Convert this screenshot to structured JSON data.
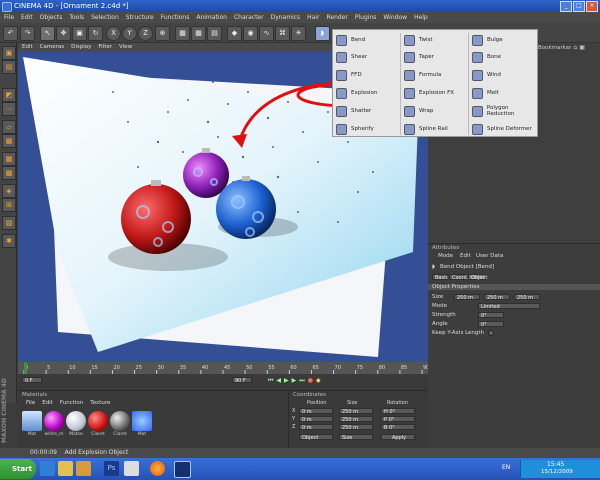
{
  "title": "CINEMA 4D - [Ornament 2.c4d *]",
  "menu": [
    "File",
    "Edit",
    "Objects",
    "Tools",
    "Selection",
    "Structure",
    "Functions",
    "Animation",
    "Character",
    "Dynamics",
    "Hair",
    "Render",
    "Plugins",
    "Window",
    "Help"
  ],
  "viewport_menu": [
    "Edit",
    "Cameras",
    "Display",
    "Filter",
    "View"
  ],
  "right_header": "Bookmarks",
  "deformers": [
    [
      "Bend",
      "Shear",
      "FFD",
      "Explosion",
      "Shatter",
      "Spherify"
    ],
    [
      "Twist",
      "Taper",
      "Formula",
      "Explosion FX",
      "Wrap",
      "Spline Rail"
    ],
    [
      "Bulge",
      "Bone",
      "Wind",
      "Melt",
      "Polygon Reduction",
      "Spline Deformer"
    ]
  ],
  "attributes": {
    "header": "Attributes",
    "tabs": [
      "Mode",
      "Edit",
      "User Data"
    ],
    "object_name": "Bend Object [Bend]",
    "subtabs": [
      "Basic",
      "Coord.",
      "Object"
    ],
    "section": "Object Properties",
    "size_label": "Size",
    "size_values": [
      "250 m",
      "250 m",
      "250 m"
    ],
    "mode_label": "Mode",
    "mode_value": "Limited",
    "strength_label": "Strength",
    "strength_value": "0°",
    "angle_label": "Angle",
    "angle_value": "0°",
    "keep_label": "Keep Y-Axis Length"
  },
  "timeline": {
    "start": "0 F",
    "end": "90 F",
    "ticks": [
      "0",
      "5",
      "10",
      "15",
      "20",
      "25",
      "30",
      "35",
      "40",
      "45",
      "50",
      "55",
      "60",
      "65",
      "70",
      "75",
      "80",
      "85",
      "90"
    ]
  },
  "materials": {
    "header": "Materials",
    "menu": [
      "File",
      "Edit",
      "Function",
      "Texture"
    ],
    "items": [
      "Mat",
      "white_m",
      "Matse",
      "Claret",
      "Claret",
      "Mat"
    ]
  },
  "coords": {
    "header": "Coordinates",
    "columns": [
      "Position",
      "Size",
      "Rotation"
    ],
    "rows": [
      {
        "axis": "X",
        "pos": "0 m",
        "size": "250 m",
        "rot": "H 0°"
      },
      {
        "axis": "Y",
        "pos": "0 m",
        "size": "250 m",
        "rot": "P 0°"
      },
      {
        "axis": "Z",
        "pos": "0 m",
        "size": "250 m",
        "rot": "B 0°"
      }
    ],
    "mode1": "Object",
    "mode2": "Size",
    "apply": "Apply"
  },
  "status": {
    "time": "00:00:09",
    "text": "Add Explosion Object"
  },
  "taskbar": {
    "start": "Start",
    "lang": "EN",
    "clock": "15:45",
    "date": "15/12/2009"
  },
  "brand": "MAXON CINEMA 4D"
}
